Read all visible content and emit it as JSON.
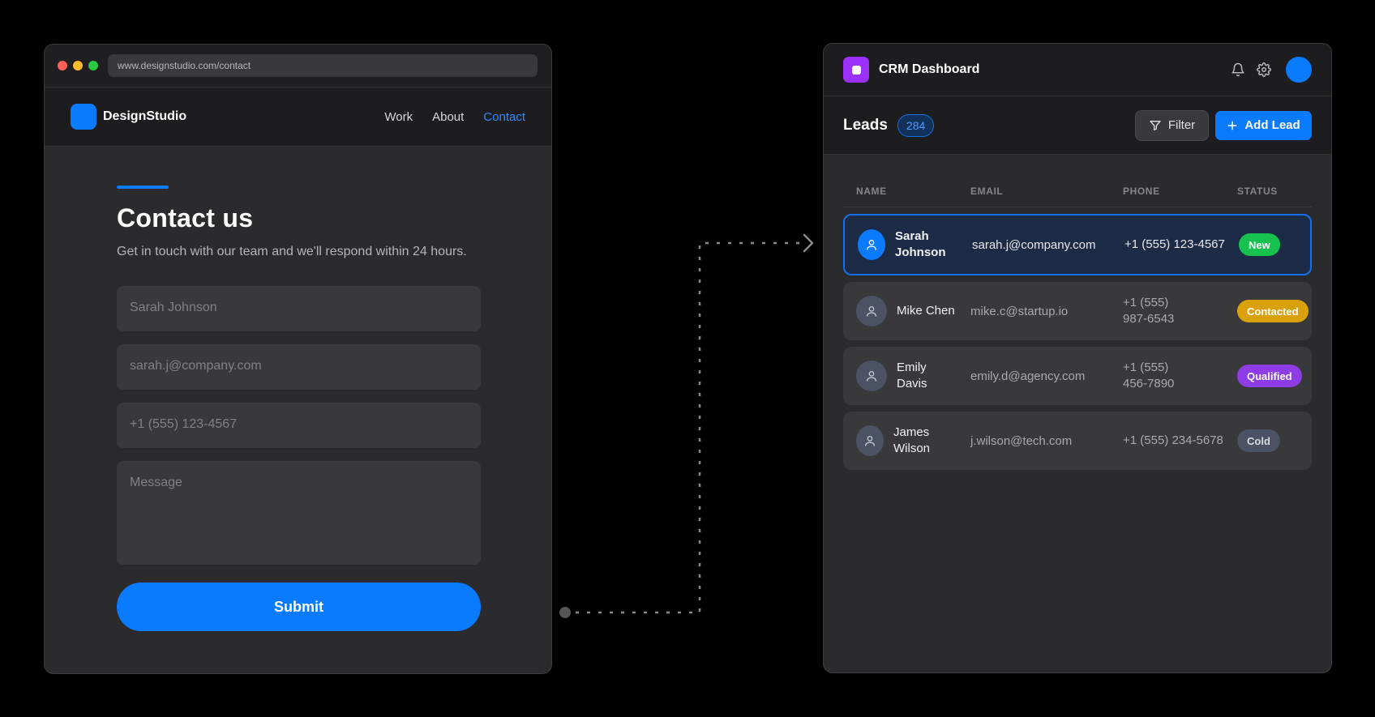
{
  "browser": {
    "url": "www.designstudio.com/contact",
    "brand": "DesignStudio",
    "nav": [
      {
        "label": "Work"
      },
      {
        "label": "About"
      },
      {
        "label": "Contact"
      }
    ]
  },
  "contact": {
    "title": "Contact us",
    "subtitle": "Get in touch with our team and we'll respond within 24 hours.",
    "fields": {
      "name": "Sarah Johnson",
      "email": "sarah.j@company.com",
      "phone": "+1 (555) 123-4567",
      "message": "Message"
    },
    "submit_label": "Submit"
  },
  "crm": {
    "title": "CRM Dashboard",
    "leads_title": "Leads",
    "leads_count": "284",
    "filter_label": "Filter",
    "add_label": "Add Lead",
    "columns": [
      "NAME",
      "EMAIL",
      "PHONE",
      "STATUS"
    ],
    "rows": [
      {
        "name": "Sarah Johnson",
        "email": "sarah.j@company.com",
        "phone": "+1 (555) 123-4567",
        "status": "New",
        "status_color": "#16c24d"
      },
      {
        "name": "Mike Chen",
        "email": "mike.c@startup.io",
        "phone": "+1 (555) 987-6543",
        "status": "Contacted",
        "status_color": "#d9a10c"
      },
      {
        "name": "Emily Davis",
        "email": "emily.d@agency.com",
        "phone": "+1 (555) 456-7890",
        "status": "Qualified",
        "status_color": "#8e3ce6"
      },
      {
        "name": "James Wilson",
        "email": "j.wilson@tech.com",
        "phone": "+1 (555) 234-5678",
        "status": "Cold",
        "status_color": "#4a5264"
      }
    ]
  },
  "colors": {
    "accent": "#0a7bff",
    "app_icon": "#9b30ff"
  },
  "icons": [
    "bell-icon",
    "gear-icon",
    "filter-icon",
    "plus-icon",
    "user-icon"
  ]
}
